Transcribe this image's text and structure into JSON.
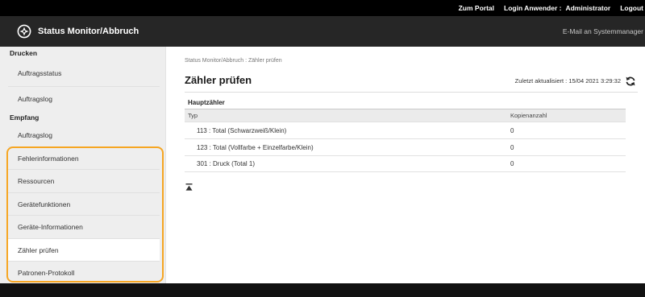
{
  "header": {
    "portal_link": "Zum Portal",
    "login_label": "Login Anwender :",
    "login_user": "Administrator",
    "logout_link": "Logout",
    "app_title": "Status Monitor/Abbruch",
    "app_icon": "status-monitor-icon",
    "mail_link": "E-Mail an Systemmanager"
  },
  "sidebar": {
    "print": {
      "heading": "Drucken",
      "items": [
        {
          "label": "Auftragsstatus"
        },
        {
          "label": "Auftragslog"
        }
      ]
    },
    "receive": {
      "heading": "Empfang",
      "items": [
        {
          "label": "Auftragslog"
        }
      ]
    },
    "links": [
      {
        "label": "Fehlerinformationen"
      },
      {
        "label": "Ressourcen"
      },
      {
        "label": "Gerätefunktionen"
      },
      {
        "label": "Geräte-Informationen"
      },
      {
        "label": "Zähler prüfen",
        "selected": true
      },
      {
        "label": "Patronen-Protokoll"
      }
    ]
  },
  "main": {
    "breadcrumb": "Status Monitor/Abbruch : Zähler prüfen",
    "title": "Zähler prüfen",
    "last_updated": "Zuletzt aktualisiert : 15/04 2021 3:29:32",
    "refresh_icon": "refresh-icon",
    "section_title": "Hauptzähler",
    "table": {
      "columns": [
        "Typ",
        "Kopienanzahl"
      ],
      "rows": [
        {
          "type": "113 : Total (Schwarzweiß/Klein)",
          "count": "0"
        },
        {
          "type": "123 : Total (Vollfarbe + Einzelfarbe/Klein)",
          "count": "0"
        },
        {
          "type": "301 : Druck (Total 1)",
          "count": "0"
        }
      ]
    },
    "back_to_top_icon": "back-to-top-icon"
  },
  "colors": {
    "highlight": "#f6a623",
    "topbar": "#000000",
    "titlebar": "#262626",
    "sidebar": "#eeeeee",
    "selected": "#ffffff",
    "footer": "#111111"
  }
}
